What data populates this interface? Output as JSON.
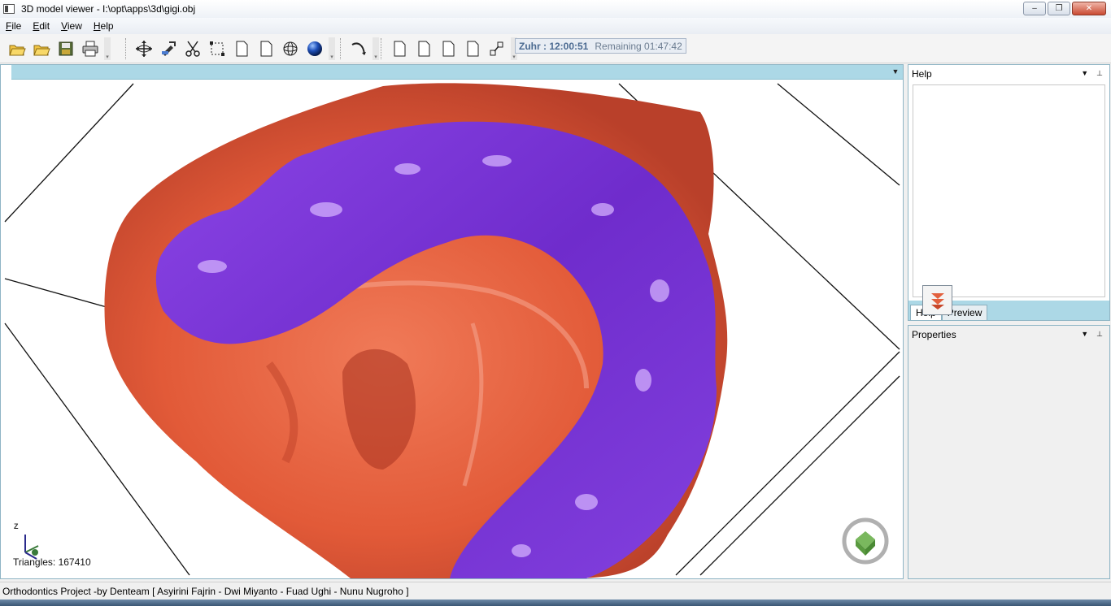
{
  "window": {
    "title": "3D model viewer - I:\\opt\\apps\\3d\\gigi.obj",
    "minimize": "–",
    "maximize": "❐",
    "close": "✕"
  },
  "menu": {
    "items": [
      {
        "label": "File",
        "accel": "F",
        "rest": "ile"
      },
      {
        "label": "Edit",
        "accel": "E",
        "rest": "dit"
      },
      {
        "label": "View",
        "accel": "V",
        "rest": "iew"
      },
      {
        "label": "Help",
        "accel": "H",
        "rest": "elp"
      }
    ]
  },
  "toolbar": {
    "icons": [
      "open-folder-icon",
      "open-folder-icon",
      "save-icon",
      "print-icon",
      "rotate-move-icon",
      "select-tool-icon",
      "cut-icon",
      "transform-icon",
      "blank-page-icon",
      "blank-page-icon",
      "wireframe-sphere-icon",
      "solid-sphere-icon",
      "curve-icon",
      "blank-page-icon",
      "blank-page-icon",
      "blank-page-icon",
      "blank-page-icon",
      "fit-view-icon"
    ]
  },
  "prayer": {
    "current": "Zuhr : 12:00:51",
    "remaining": "Remaining 01:47:42"
  },
  "viewport": {
    "triangles": "Triangles: 167410",
    "axis": "Z",
    "colors": {
      "gum": "#e9603f",
      "aligner": "#7a35d6",
      "background": "#ffffff"
    }
  },
  "panels": {
    "help": {
      "title": "Help",
      "tabs": [
        "Help",
        "Preview"
      ]
    },
    "properties": {
      "title": "Properties"
    },
    "pin": "⊥",
    "dropdown": "▼"
  },
  "status": {
    "text": "Orthodontics Project -by Denteam [ Asyirini Fajrin - Dwi Miyanto - Fuad Ughi - Nunu Nugroho ]"
  }
}
